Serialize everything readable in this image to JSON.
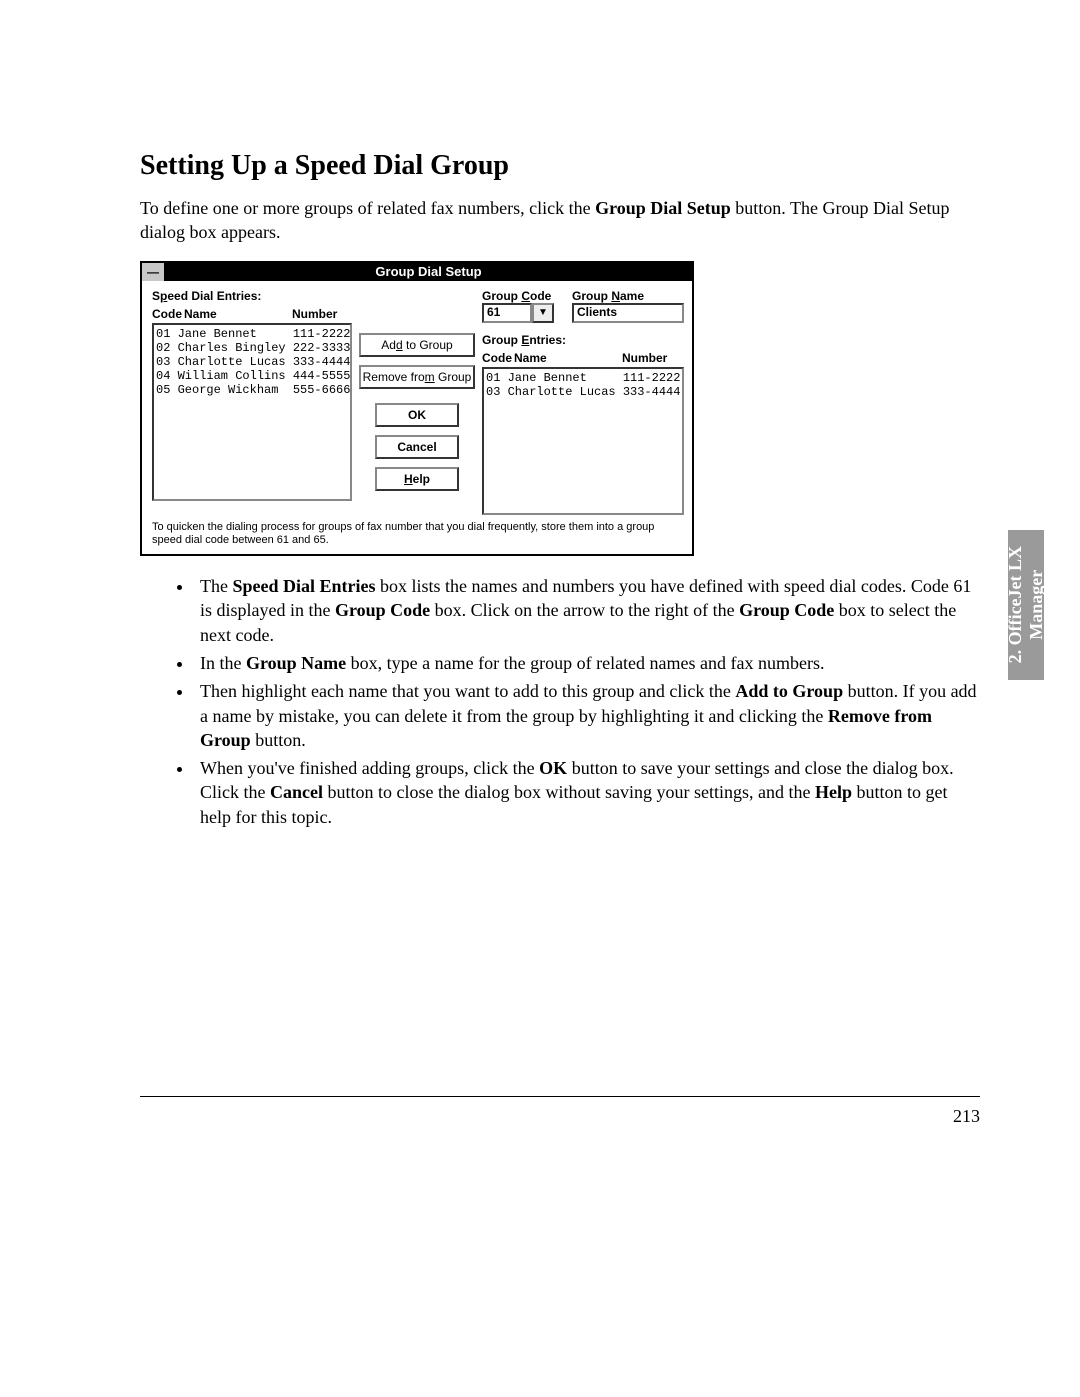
{
  "heading": "Setting Up a Speed Dial Group",
  "intro_pre": "To define one or more groups of related fax numbers, click the ",
  "intro_bold": "Group Dial Setup",
  "intro_post": " button. The Group Dial Setup dialog box appears.",
  "dialog": {
    "title": "Group Dial Setup",
    "speed_dial_label_prefix": "S",
    "speed_dial_label_ul": "p",
    "speed_dial_label_suffix": "eed Dial Entries:",
    "col_code": "Code",
    "col_name": "Name",
    "col_number": "Number",
    "speed_entries": [
      {
        "code": "01",
        "name": "Jane Bennet",
        "number": "111-2222"
      },
      {
        "code": "02",
        "name": "Charles Bingley",
        "number": "222-3333"
      },
      {
        "code": "03",
        "name": "Charlotte Lucas",
        "number": "333-4444"
      },
      {
        "code": "04",
        "name": "William Collins",
        "number": "444-5555"
      },
      {
        "code": "05",
        "name": "George Wickham",
        "number": "555-6666"
      }
    ],
    "btn_add_prefix": "Ad",
    "btn_add_ul": "d",
    "btn_add_suffix": " to Group",
    "btn_remove_prefix": "Remove fro",
    "btn_remove_ul": "m",
    "btn_remove_suffix": " Group",
    "btn_ok": "OK",
    "btn_cancel": "Cancel",
    "btn_help_ul": "H",
    "btn_help_suffix": "elp",
    "group_code_label_prefix": "Group ",
    "group_code_label_ul": "C",
    "group_code_label_suffix": "ode",
    "group_name_label_prefix": "Group ",
    "group_name_label_ul": "N",
    "group_name_label_suffix": "ame",
    "group_code_value": "61",
    "group_name_value": "Clients",
    "group_entries_label_prefix": "Group ",
    "group_entries_label_ul": "E",
    "group_entries_label_suffix": "ntries:",
    "group_entries": [
      {
        "code": "01",
        "name": "Jane Bennet",
        "number": "111-2222"
      },
      {
        "code": "03",
        "name": "Charlotte Lucas",
        "number": "333-4444"
      }
    ],
    "hint": "To quicken the dialing process for groups of fax number that you dial frequently, store them into a group speed dial code between 61 and 65."
  },
  "bullets": {
    "b1_a": "The ",
    "b1_b": "Speed Dial Entries",
    "b1_c": " box lists the names and numbers you have defined with speed dial codes. Code 61 is displayed in the ",
    "b1_d": "Group Code",
    "b1_e": " box. Click on the arrow to the right of the ",
    "b1_f": "Group Code",
    "b1_g": " box to select the next code.",
    "b2_a": "In the ",
    "b2_b": "Group Name",
    "b2_c": " box, type a name for the group of related names and fax numbers.",
    "b3_a": "Then highlight each name that you want to add to this group and click the ",
    "b3_b": "Add to Group",
    "b3_c": " button. If you add a name by mistake, you can delete it from the group by highlighting it and clicking the ",
    "b3_d": "Remove from Group",
    "b3_e": " button.",
    "b4_a": "When you've finished adding groups, click the ",
    "b4_b": "OK",
    "b4_c": " button to save your settings and close the dialog box. Click the ",
    "b4_d": "Cancel",
    "b4_e": " button to close the dialog box without saving your settings, and the ",
    "b4_f": "Help",
    "b4_g": " button to get help for this topic."
  },
  "side_tab_line1": "2. OfficeJet LX",
  "side_tab_line2": "Manager",
  "page_number": "213"
}
